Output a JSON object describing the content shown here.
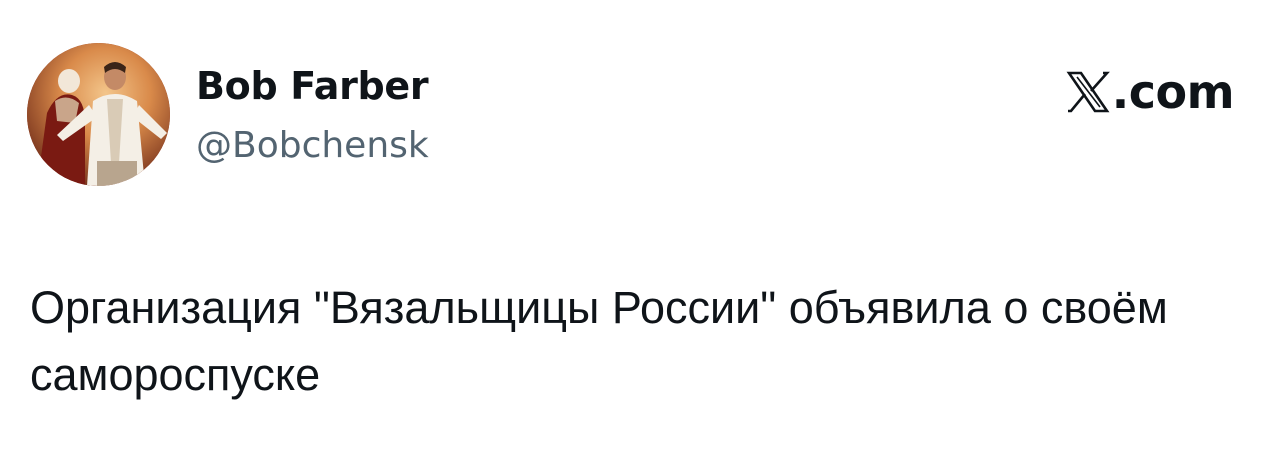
{
  "author": {
    "display_name": "Bob Farber",
    "handle": "@Bobchensk",
    "avatar_icon": "profile-photo"
  },
  "brand": {
    "logo_icon": "x-logo-icon",
    "label": ".com"
  },
  "tweet": {
    "text": "Организация \"Вязальщицы России\" объявила о своём самороспуске"
  },
  "colors": {
    "text_primary": "#0f1419",
    "text_secondary": "#536471",
    "background": "#ffffff"
  }
}
